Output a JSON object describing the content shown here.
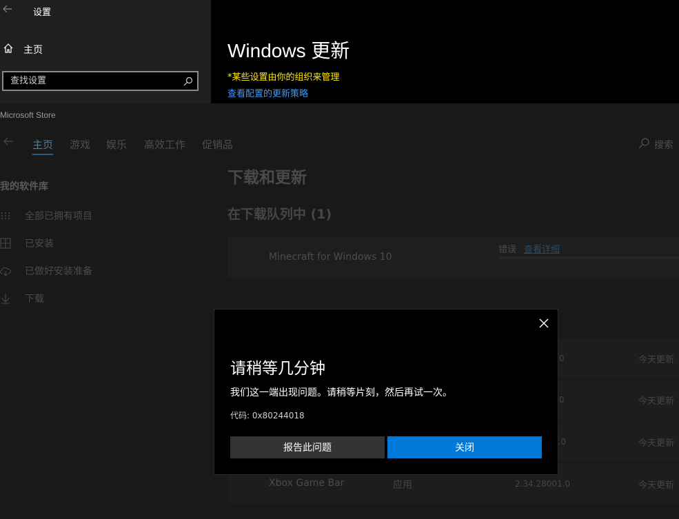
{
  "settings": {
    "title": "设置",
    "home_label": "主页",
    "search_placeholder": "查找设置",
    "update_title": "Windows 更新",
    "policy_note": "*某些设置由你的组织来管理",
    "policy_link": "查看配置的更新策略"
  },
  "store": {
    "title": "Microsoft Store",
    "nav": [
      "主页",
      "游戏",
      "娱乐",
      "高效工作",
      "促销品"
    ],
    "search_label": "搜索",
    "library_title": "我的软件库",
    "library_items": [
      "全部已拥有项目",
      "已安装",
      "已做好安装准备",
      "下载"
    ],
    "downloads_title": "下载和更新",
    "queue_heading": "在下载队列中 (1)",
    "queue_item": {
      "name": "Minecraft for Windows 10",
      "status": "错误",
      "link": "查看详细"
    },
    "recent_rows": [
      {
        "version": "0",
        "date": "今天更新"
      },
      {
        "version": "0",
        "date": "今天更新"
      },
      {
        "version": "1.0",
        "date": "今天更新"
      },
      {
        "name": "Xbox Game Bar",
        "type": "应用",
        "version": "2.34.28001.0",
        "date": "今天更新"
      }
    ]
  },
  "dialog": {
    "title": "请稍等几分钟",
    "message": "我们这一端出现问题。请稍等片刻，然后再试一次。",
    "code": "代码: 0x80244018",
    "report_button": "报告此问题",
    "close_button": "关闭"
  },
  "colors": {
    "accent": "#0078d7",
    "policy_note": "#ffe800",
    "link": "#3c9bff"
  }
}
